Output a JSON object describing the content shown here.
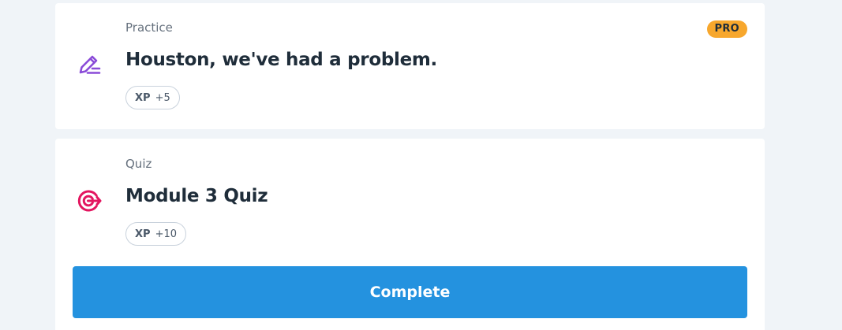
{
  "practice_card": {
    "kind": "Practice",
    "title": "Houston, we've had a problem.",
    "badge": "PRO",
    "xp_label": "XP",
    "xp_value": "+5",
    "icon": "pencil-icon",
    "icon_color": "#8a4bd8"
  },
  "quiz_card": {
    "kind": "Quiz",
    "title": "Module 3 Quiz",
    "xp_label": "XP",
    "xp_value": "+10",
    "icon": "target-icon",
    "icon_color": "#e3155f",
    "button_label": "Complete"
  },
  "colors": {
    "background": "#f0f4f8",
    "button": "#2492df",
    "pro_badge": "#f7a72d"
  }
}
